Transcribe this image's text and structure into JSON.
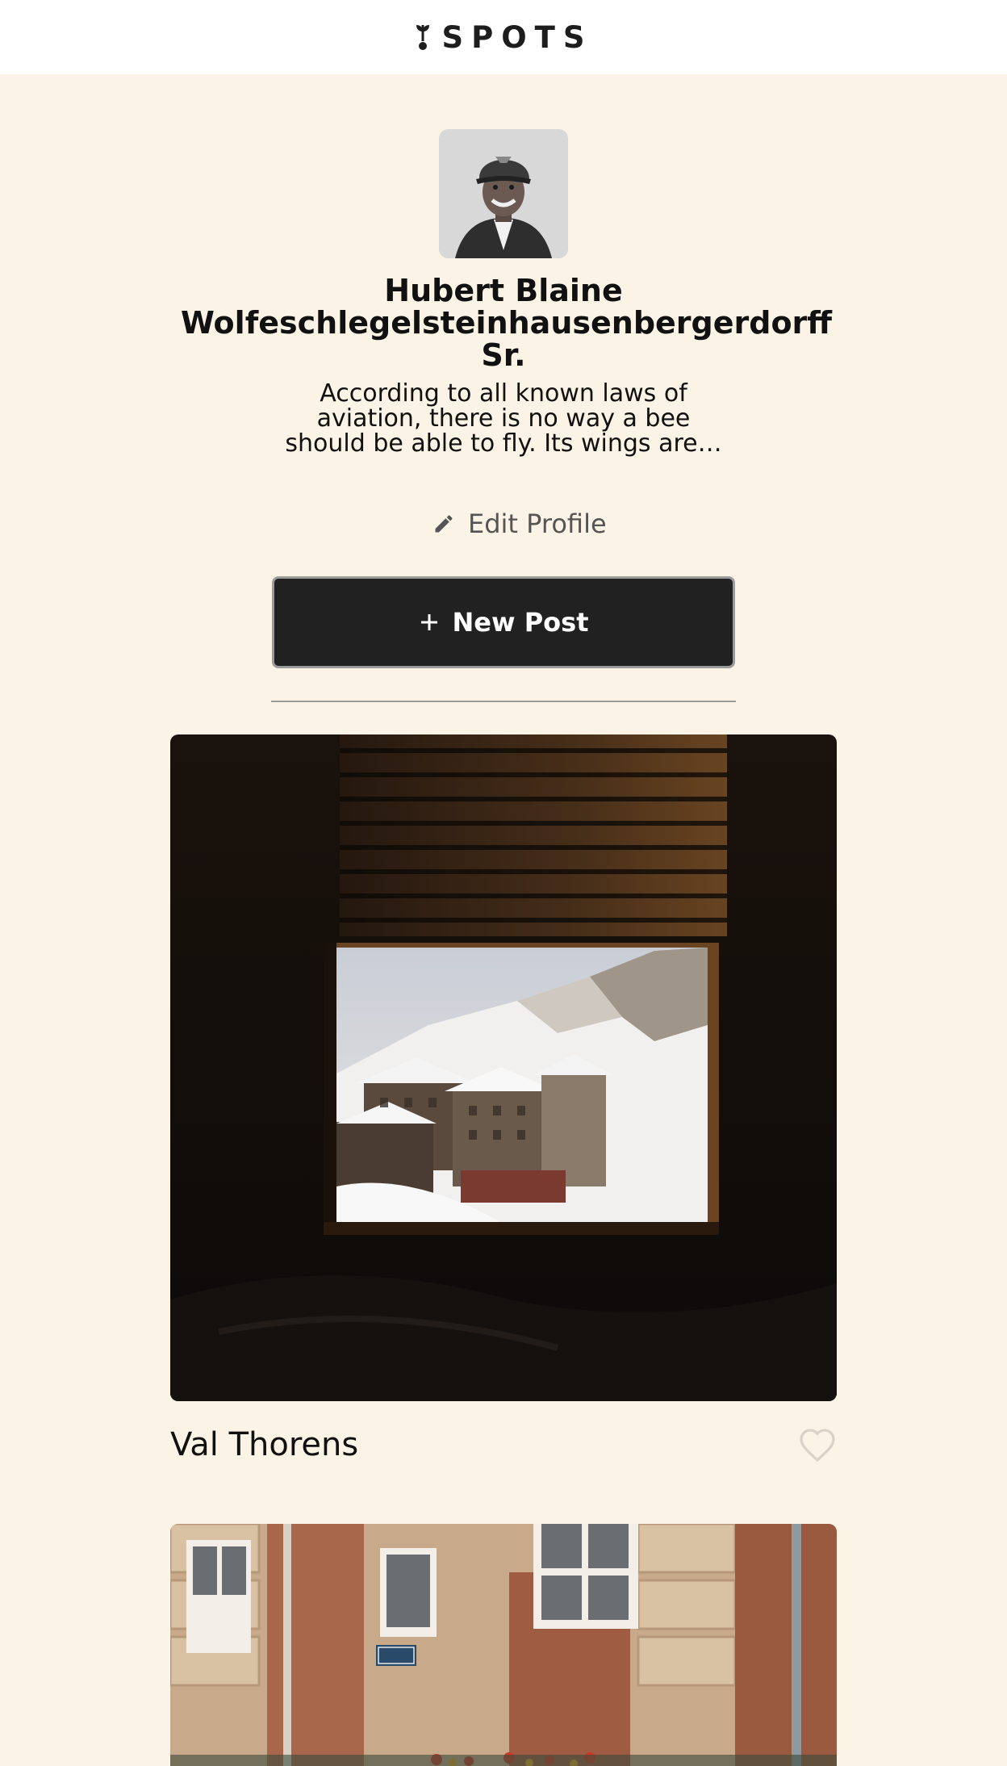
{
  "header": {
    "logo_icon": "sprout-icon",
    "logo_text": "SPOTS"
  },
  "profile": {
    "avatar_alt": "profile-photo",
    "name": "Hubert Blaine Wolfeschlegelsteinhausenbergerdorff Sr.",
    "bio": "According to all known laws of aviation, there is no way a bee should be able to fly. Its wings are…"
  },
  "actions": {
    "edit_profile_label": "Edit Profile",
    "edit_icon": "pencil-icon",
    "new_post_label": "New Post",
    "new_post_icon": "plus-icon"
  },
  "posts": [
    {
      "title": "Val Thorens",
      "liked": false,
      "like_icon": "heart-icon"
    },
    {
      "title": "",
      "liked": false,
      "like_icon": "heart-icon"
    }
  ],
  "colors": {
    "page_background": "#fbf3e5",
    "header_background": "#ffffff",
    "button_background": "#212121",
    "button_text": "#ffffff",
    "muted_text": "#555555"
  }
}
